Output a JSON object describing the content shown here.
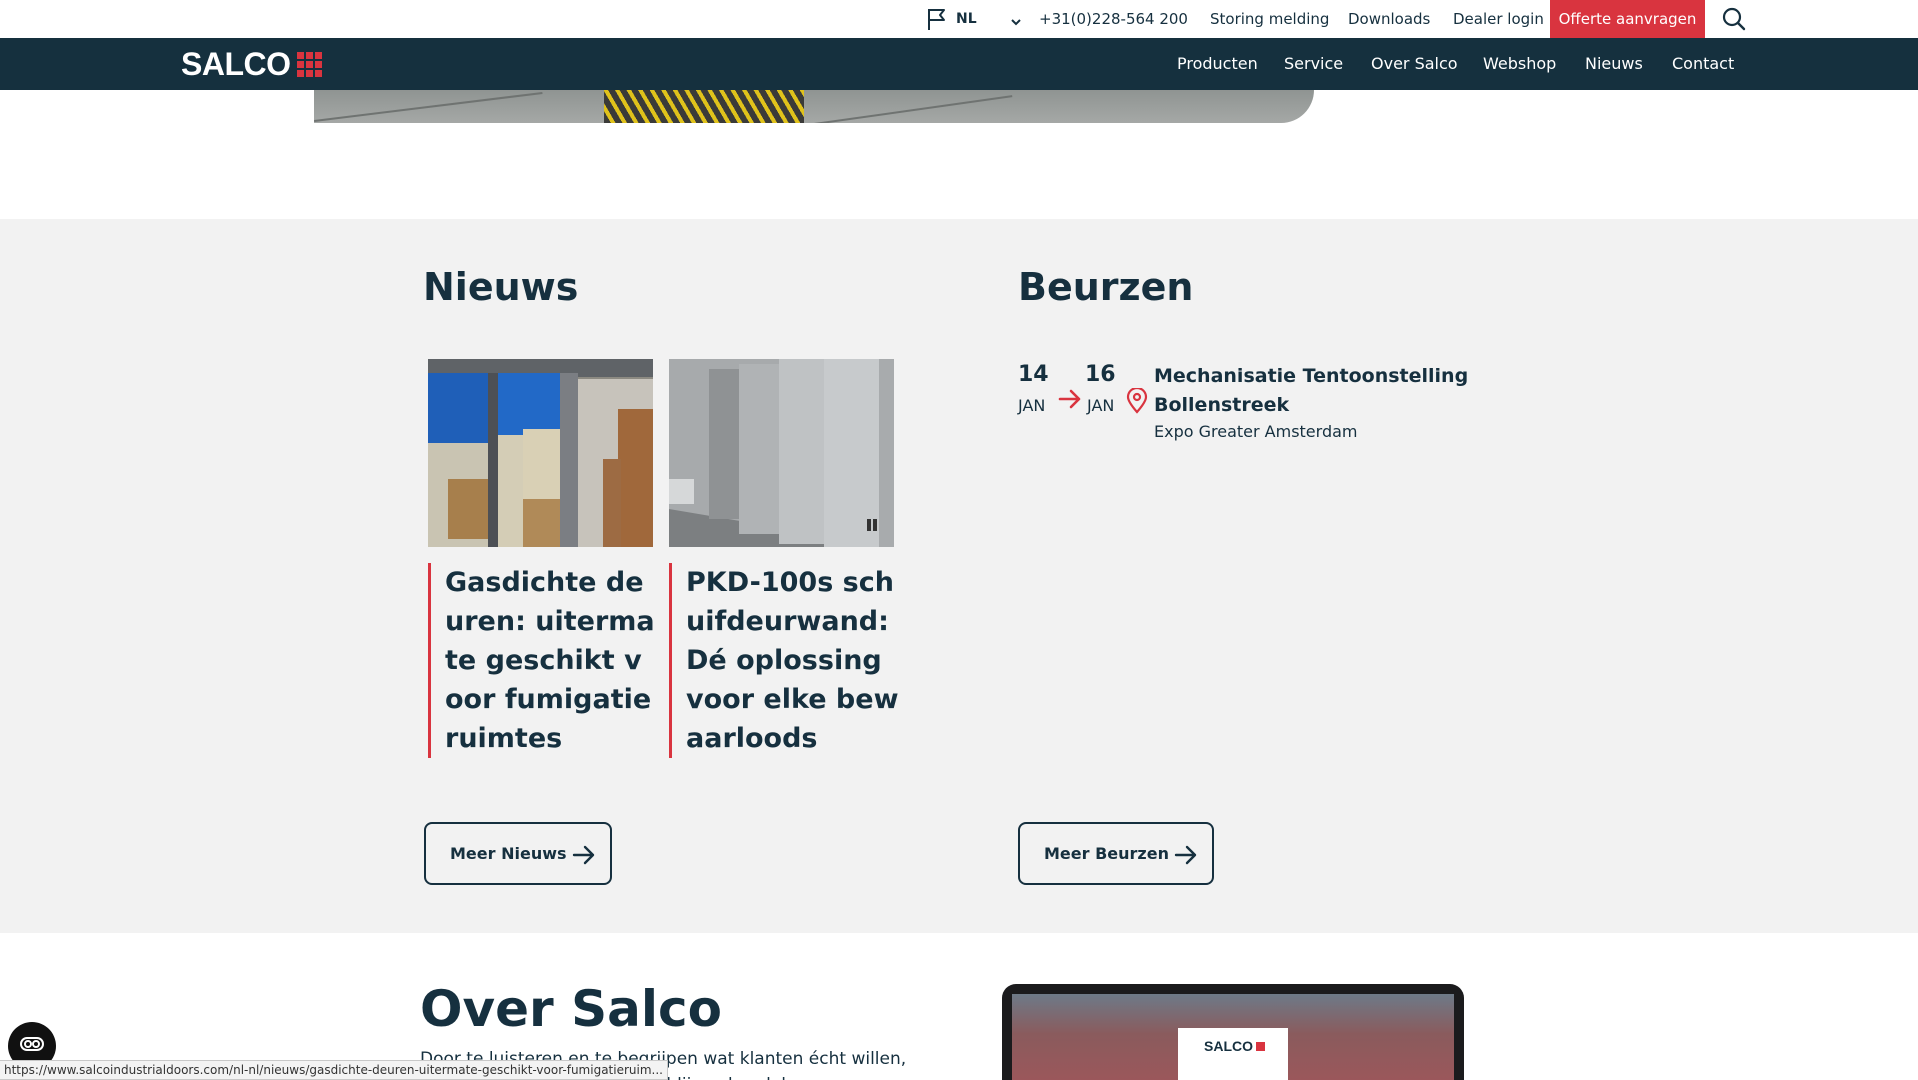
{
  "topbar": {
    "language": "NL",
    "phone": "+31(0)228-564 200",
    "links": [
      "Storing melding",
      "Downloads",
      "Dealer login"
    ],
    "cta": "Offerte aanvragen"
  },
  "brand": {
    "logo_text": "SALCO",
    "accent": "#d9343f",
    "navy": "#15303e"
  },
  "nav": {
    "items": [
      "Producten",
      "Service",
      "Over Salco",
      "Webshop",
      "Nieuws",
      "Contact"
    ]
  },
  "news": {
    "heading": "Nieuws",
    "articles": [
      {
        "title": "Gasdichte deuren: uitermate geschikt voor fumigatieruimtes"
      },
      {
        "title": "PKD-100s schuifdeurwand: Dé oplossing voor elke bewaarloods"
      }
    ],
    "more_button": "Meer Nieuws"
  },
  "fairs": {
    "heading": "Beurzen",
    "events": [
      {
        "start_day": "14",
        "start_month": "JAN",
        "end_day": "16",
        "end_month": "JAN",
        "title": "Mechanisatie Tentoonstelling Bollenstreek",
        "location": "Expo Greater Amsterdam"
      }
    ],
    "more_button": "Meer Beurzen"
  },
  "about": {
    "heading": "Over Salco",
    "text": "Door te luisteren en te begrijpen wat klanten écht willen, kunnen wij ... ören. Hierdoor blijven handel en",
    "laptop_logo": "SALCO"
  },
  "statusbar": {
    "url": "https://www.salcoindustrialdoors.com/nl-nl/nieuws/gasdichte-deuren-uitermate-geschikt-voor-fumigatieruim..."
  }
}
